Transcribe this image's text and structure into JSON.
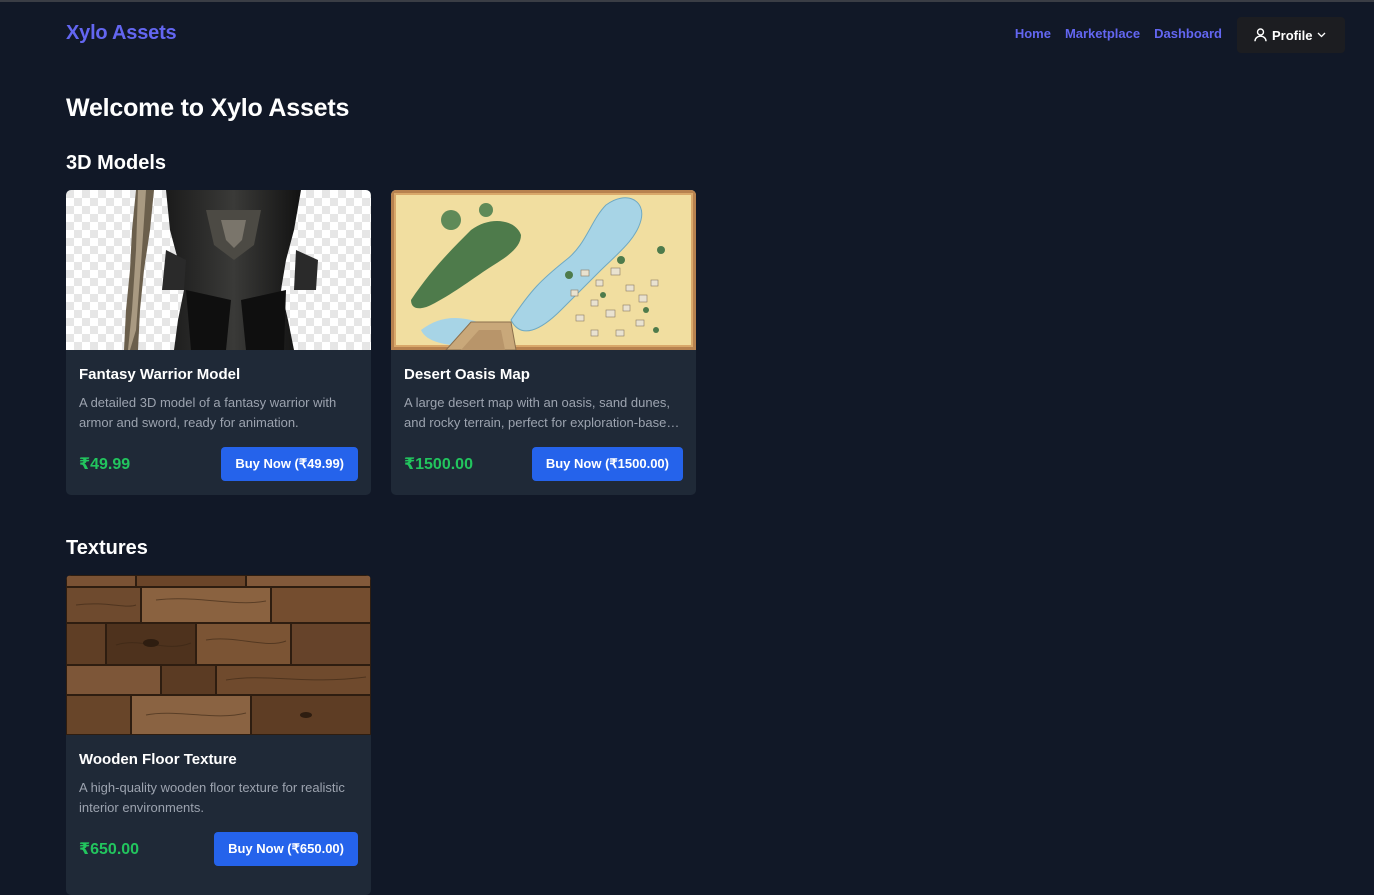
{
  "brand": "Xylo Assets",
  "nav": {
    "links": [
      "Home",
      "Marketplace",
      "Dashboard"
    ],
    "profile_label": "Profile",
    "profile_icon": "user-icon",
    "caret_icon": "chevron-down-icon"
  },
  "page_title": "Welcome to Xylo Assets",
  "sections": [
    {
      "title": "3D Models",
      "items": [
        {
          "name": "Fantasy Warrior Model",
          "description": "A detailed 3D model of a fantasy warrior with armor and sword, ready for animation.",
          "price": "₹49.99",
          "button": "Buy Now (₹49.99)"
        },
        {
          "name": "Desert Oasis Map",
          "description": "A large desert map with an oasis, sand dunes, and rocky terrain, perfect for exploration-based games.",
          "price": "₹1500.00",
          "button": "Buy Now (₹1500.00)"
        }
      ]
    },
    {
      "title": "Textures",
      "items": [
        {
          "name": "Wooden Floor Texture",
          "description": "A high-quality wooden floor texture for realistic interior environments.",
          "price": "₹650.00",
          "button": "Buy Now (₹650.00)"
        }
      ]
    }
  ],
  "colors": {
    "background": "#111827",
    "card": "#1f2937",
    "accent": "#6366f1",
    "price": "#22c55e",
    "button": "#2563eb"
  }
}
